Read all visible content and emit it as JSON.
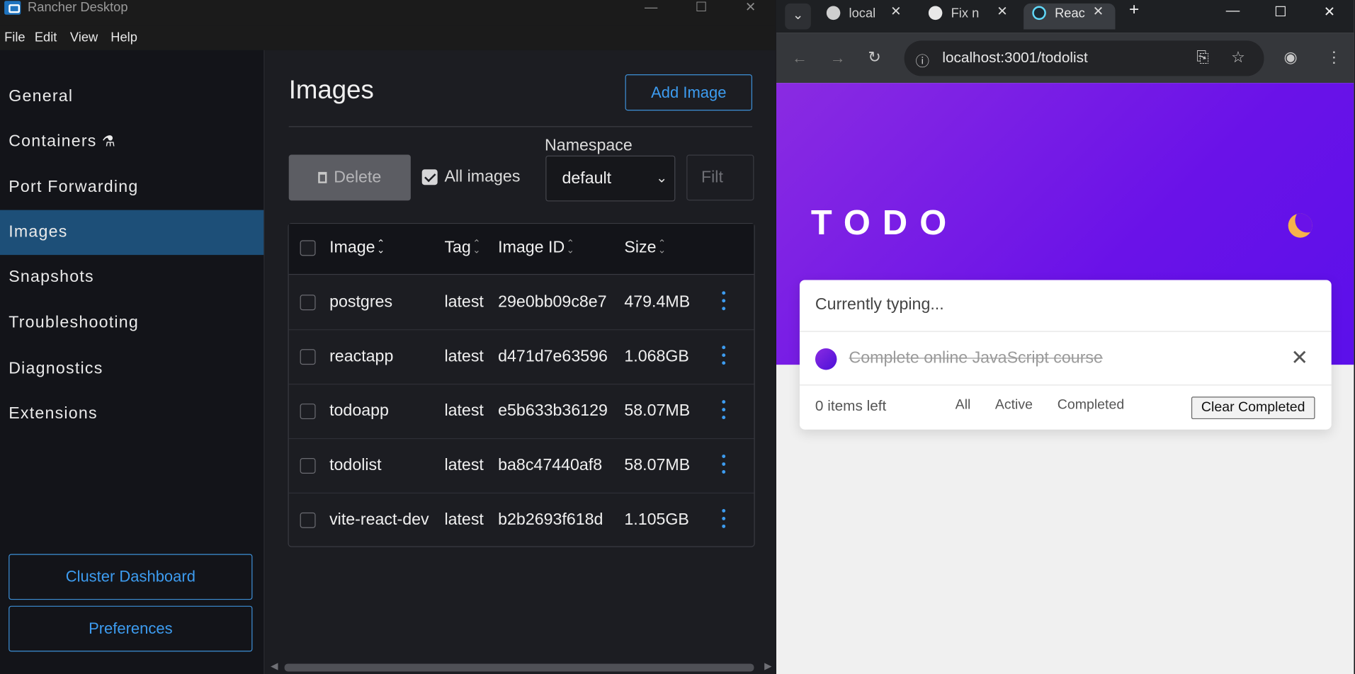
{
  "rancher": {
    "title": "Rancher Desktop",
    "menu": [
      "File",
      "Edit",
      "View",
      "Help"
    ],
    "sidebar": {
      "items": [
        {
          "label": "General"
        },
        {
          "label": "Containers"
        },
        {
          "label": "Port Forwarding"
        },
        {
          "label": "Images",
          "active": true
        },
        {
          "label": "Snapshots"
        },
        {
          "label": "Troubleshooting"
        },
        {
          "label": "Diagnostics"
        },
        {
          "label": "Extensions"
        }
      ],
      "cluster_dashboard": "Cluster Dashboard",
      "preferences": "Preferences"
    },
    "main": {
      "heading": "Images",
      "add_image": "Add Image",
      "delete": "Delete",
      "all_images": "All images",
      "all_images_checked": true,
      "namespace_label": "Namespace",
      "namespace_value": "default",
      "filter_placeholder": "Filt",
      "columns": [
        "Image",
        "Tag",
        "Image ID",
        "Size"
      ],
      "rows": [
        {
          "image": "postgres",
          "tag": "latest",
          "id": "29e0bb09c8e7",
          "size": "479.4MB"
        },
        {
          "image": "reactapp",
          "tag": "latest",
          "id": "d471d7e63596",
          "size": "1.068GB"
        },
        {
          "image": "todoapp",
          "tag": "latest",
          "id": "e5b633b36129",
          "size": "58.07MB"
        },
        {
          "image": "todolist",
          "tag": "latest",
          "id": "ba8c47440af8",
          "size": "58.07MB"
        },
        {
          "image": "vite-react-dev",
          "tag": "latest",
          "id": "b2b2693f618d",
          "size": "1.105GB"
        }
      ]
    },
    "colors": {
      "accent": "#3d9cf0",
      "active_nav": "#1d4f78"
    }
  },
  "browser": {
    "tabs": [
      {
        "title": "local",
        "icon": "globe-icon"
      },
      {
        "title": "Fix n",
        "icon": "openai-icon"
      },
      {
        "title": "Reac",
        "icon": "react-icon",
        "active": true
      }
    ],
    "url": "localhost:3001/todolist",
    "todo": {
      "title": "TODO",
      "input_value": "Currently typing...",
      "items": [
        {
          "text": "Complete online JavaScript course",
          "completed": true
        }
      ],
      "items_left": "0 items left",
      "filters": [
        "All",
        "Active",
        "Completed"
      ],
      "clear_completed": "Clear Completed"
    },
    "colors": {
      "gradient_start": "#8a2be2",
      "gradient_end": "#5b10ea"
    }
  }
}
